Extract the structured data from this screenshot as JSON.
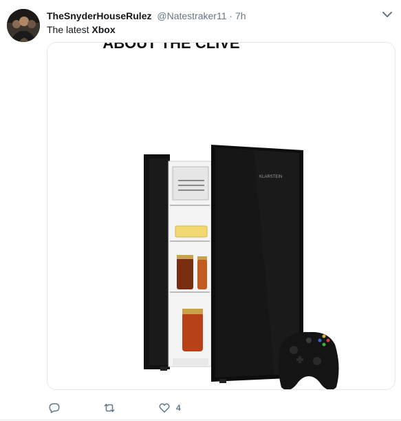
{
  "tweet": {
    "display_name": "TheSnyderHouseRulez",
    "handle": "@Natestraker11",
    "separator": "·",
    "time": "7h",
    "text_prefix": "The latest",
    "text_bold": "Xbox",
    "image_caption_fragment": "ABOUT THE CLIVE",
    "fridge_brand": "KLARSTEIN",
    "actions": {
      "reply_icon": "reply-icon",
      "retweet_icon": "retweet-icon",
      "like_icon": "heart-icon",
      "like_count": "4"
    },
    "colors": {
      "text": "#14171a",
      "secondary": "#657786",
      "border": "#e1e8ed"
    }
  }
}
